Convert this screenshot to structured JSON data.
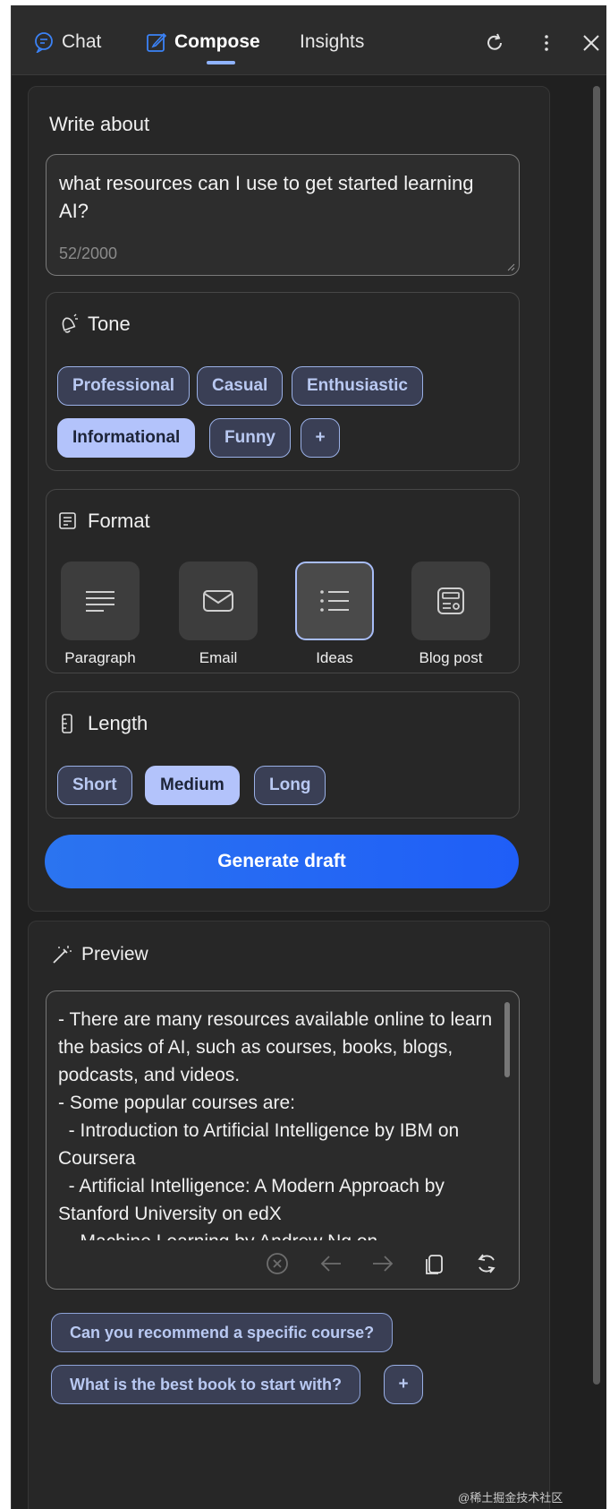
{
  "tabs": {
    "chat": "Chat",
    "compose": "Compose",
    "insights": "Insights"
  },
  "compose": {
    "write_about_label": "Write about",
    "prompt_text": "what resources can I use to get started learning AI?",
    "char_counter": "52/2000",
    "tone": {
      "title": "Tone",
      "options": [
        "Professional",
        "Casual",
        "Enthusiastic",
        "Informational",
        "Funny"
      ],
      "selected": "Informational",
      "add_label": "+"
    },
    "format": {
      "title": "Format",
      "options": [
        "Paragraph",
        "Email",
        "Ideas",
        "Blog post"
      ],
      "selected": "Ideas"
    },
    "length": {
      "title": "Length",
      "options": [
        "Short",
        "Medium",
        "Long"
      ],
      "selected": "Medium"
    },
    "generate_label": "Generate draft"
  },
  "preview": {
    "title": "Preview",
    "text": "- There are many resources available online to learn the basics of AI, such as courses, books, blogs, podcasts, and videos.\n- Some popular courses are:\n  - Introduction to Artificial Intelligence by IBM on Coursera\n  - Artificial Intelligence: A Modern Approach by Stanford University on edX\n  - Machine Learning by Andrew Ng on"
  },
  "suggestions": [
    "Can you recommend a specific course?",
    "What is the best book to start with?"
  ],
  "suggestion_add_label": "+",
  "watermark": "@稀土掘金技术社区",
  "colors": {
    "background": "#202020",
    "accent": "#1f5ef7",
    "chip_selected": "#b3c3fb",
    "chip_border": "#9ab0e6"
  }
}
